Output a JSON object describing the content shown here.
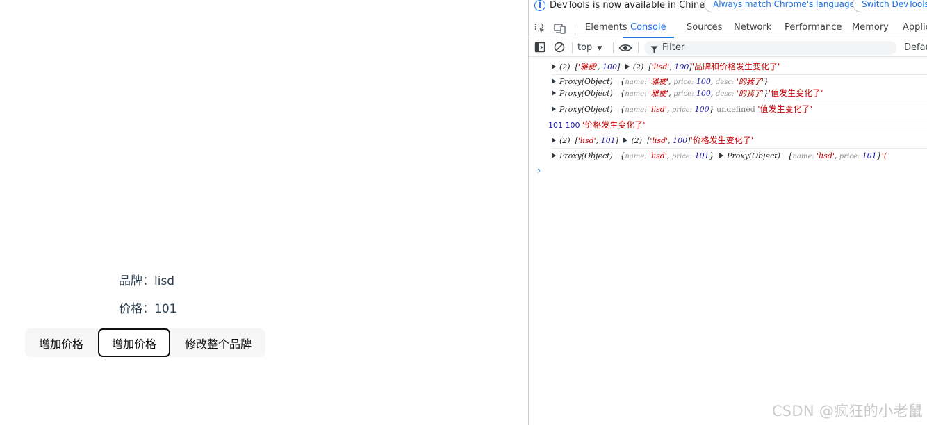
{
  "page": {
    "brand_label": "品牌：lisd",
    "price_label": "价格：101",
    "buttons": [
      "增加价格",
      "增加价格",
      "修改整个品牌"
    ]
  },
  "devtools": {
    "notice": {
      "message": "DevTools is now available in Chinese!",
      "match_language_button": "Always match Chrome's language",
      "switch_button": "Switch DevTools t"
    },
    "tabs": [
      "Elements",
      "Console",
      "Sources",
      "Network",
      "Performance",
      "Memory",
      "Applic"
    ],
    "active_tab": "Console",
    "toolbar": {
      "context": "top",
      "filter_placeholder": "Filter",
      "levels": "Defau"
    },
    "console_lines": {
      "l1": {
        "a_count": "(2)",
        "a_open": "[",
        "a_s1": "'雅梗'",
        "a_comma": ", ",
        "a_n1": "100",
        "a_close": "]",
        "b_count": "(2)",
        "b_open": "[",
        "b_s1": "'lisd'",
        "b_comma": ", ",
        "b_n1": "100",
        "b_close": "]",
        "msg": "'品牌和价格发生变化了'"
      },
      "l2": {
        "proxy": "Proxy(Object)",
        "open": "{",
        "k1": "name:",
        "v1": "'雅梗'",
        "sep1": ", ",
        "k2": "price:",
        "v2": "100",
        "sep2": ", ",
        "k3": "desc:",
        "v3": "'的我了'",
        "close": "}"
      },
      "l3": {
        "proxy": "Proxy(Object)",
        "open": "{",
        "k1": "name:",
        "v1": "'雅梗'",
        "sep1": ", ",
        "k2": "price:",
        "v2": "100",
        "sep2": ", ",
        "k3": "desc:",
        "v3": "'的我了'",
        "close": "}",
        "msg": "'值发生变化了'"
      },
      "l4": {
        "proxy": "Proxy(Object)",
        "open": "{",
        "k1": "name:",
        "v1": "'lisd'",
        "sep1": ", ",
        "k2": "price:",
        "v2": "100",
        "close": "}",
        "undef": "undefined",
        "msg": "'值发生变化了'"
      },
      "l5": {
        "n1": "101",
        "n2": "100",
        "msg": "'价格发生变化了'"
      },
      "l6": {
        "a_count": "(2)",
        "a_open": "[",
        "a_s1": "'lisd'",
        "a_comma": ", ",
        "a_n1": "101",
        "a_close": "]",
        "b_count": "(2)",
        "b_open": "[",
        "b_s1": "'lisd'",
        "b_comma": ", ",
        "b_n1": "100",
        "b_close": "]",
        "msg": "'价格发生变化了'"
      },
      "l7": {
        "proxy1": "Proxy(Object)",
        "open1": "{",
        "k1": "name:",
        "v1": "'lisd'",
        "sep1": ", ",
        "k2": "price:",
        "v2": "101",
        "close1": "}",
        "proxy2": "Proxy(Object)",
        "open2": "{",
        "k3": "name:",
        "v3": "'lisd'",
        "sep2": ", ",
        "k4": "price:",
        "v4": "101",
        "close2": "}",
        "tail": "'("
      }
    },
    "prompt": "›"
  },
  "watermark": "CSDN @疯狂的小老鼠",
  "colors": {
    "accent": "#1a73e8",
    "string": "#c80000",
    "number": "#1a1aa6",
    "key": "#8f8f8f"
  },
  "icons": [
    "info-icon",
    "inspect-element-icon",
    "device-toggle-icon",
    "sidebar-toggle-icon",
    "clear-console-icon",
    "dropdown-arrow-icon",
    "eye-icon",
    "filter-icon",
    "expand-triangle-icon",
    "prompt-chevron-icon"
  ]
}
